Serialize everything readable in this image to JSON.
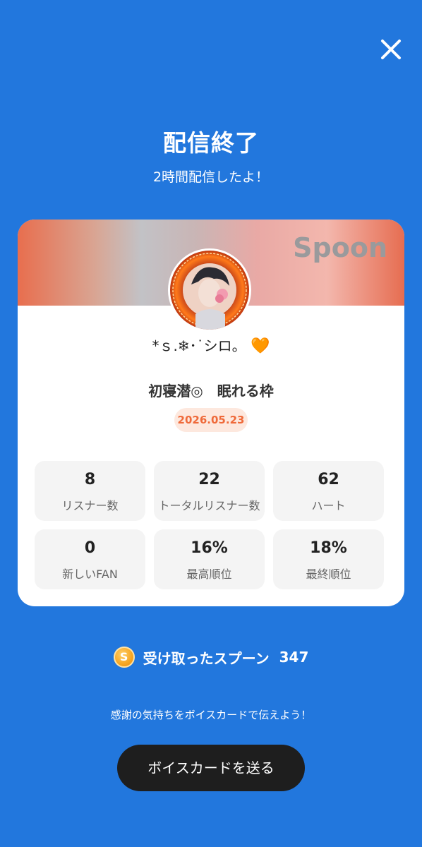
{
  "header": {
    "title": "配信終了",
    "subtitle": "2時間配信したよ！"
  },
  "card": {
    "brand": "Spoon",
    "username": "*ｓ.❄︎･˙シロ。",
    "username_emoji": "🧡",
    "stream_title": "初寝潜◎　眠れる枠",
    "date": "2026.05.23",
    "stats": [
      {
        "value": "8",
        "label": "リスナー数"
      },
      {
        "value": "22",
        "label": "トータルリスナー数"
      },
      {
        "value": "62",
        "label": "ハート"
      },
      {
        "value": "0",
        "label": "新しいFAN"
      },
      {
        "value": "16%",
        "label": "最高順位"
      },
      {
        "value": "18%",
        "label": "最終順位"
      }
    ]
  },
  "spoons": {
    "coin_symbol": "S",
    "label": "受け取ったスプーン",
    "count": "347"
  },
  "footer": {
    "message": "感謝の気持ちをボイスカードで伝えよう！",
    "button_label": "ボイスカードを送る"
  },
  "colors": {
    "background": "#2277dd",
    "date_accent": "#ef6a3a",
    "button": "#1e1e1e"
  },
  "icons": {
    "close": "close-icon",
    "coin": "spoon-coin-icon"
  }
}
